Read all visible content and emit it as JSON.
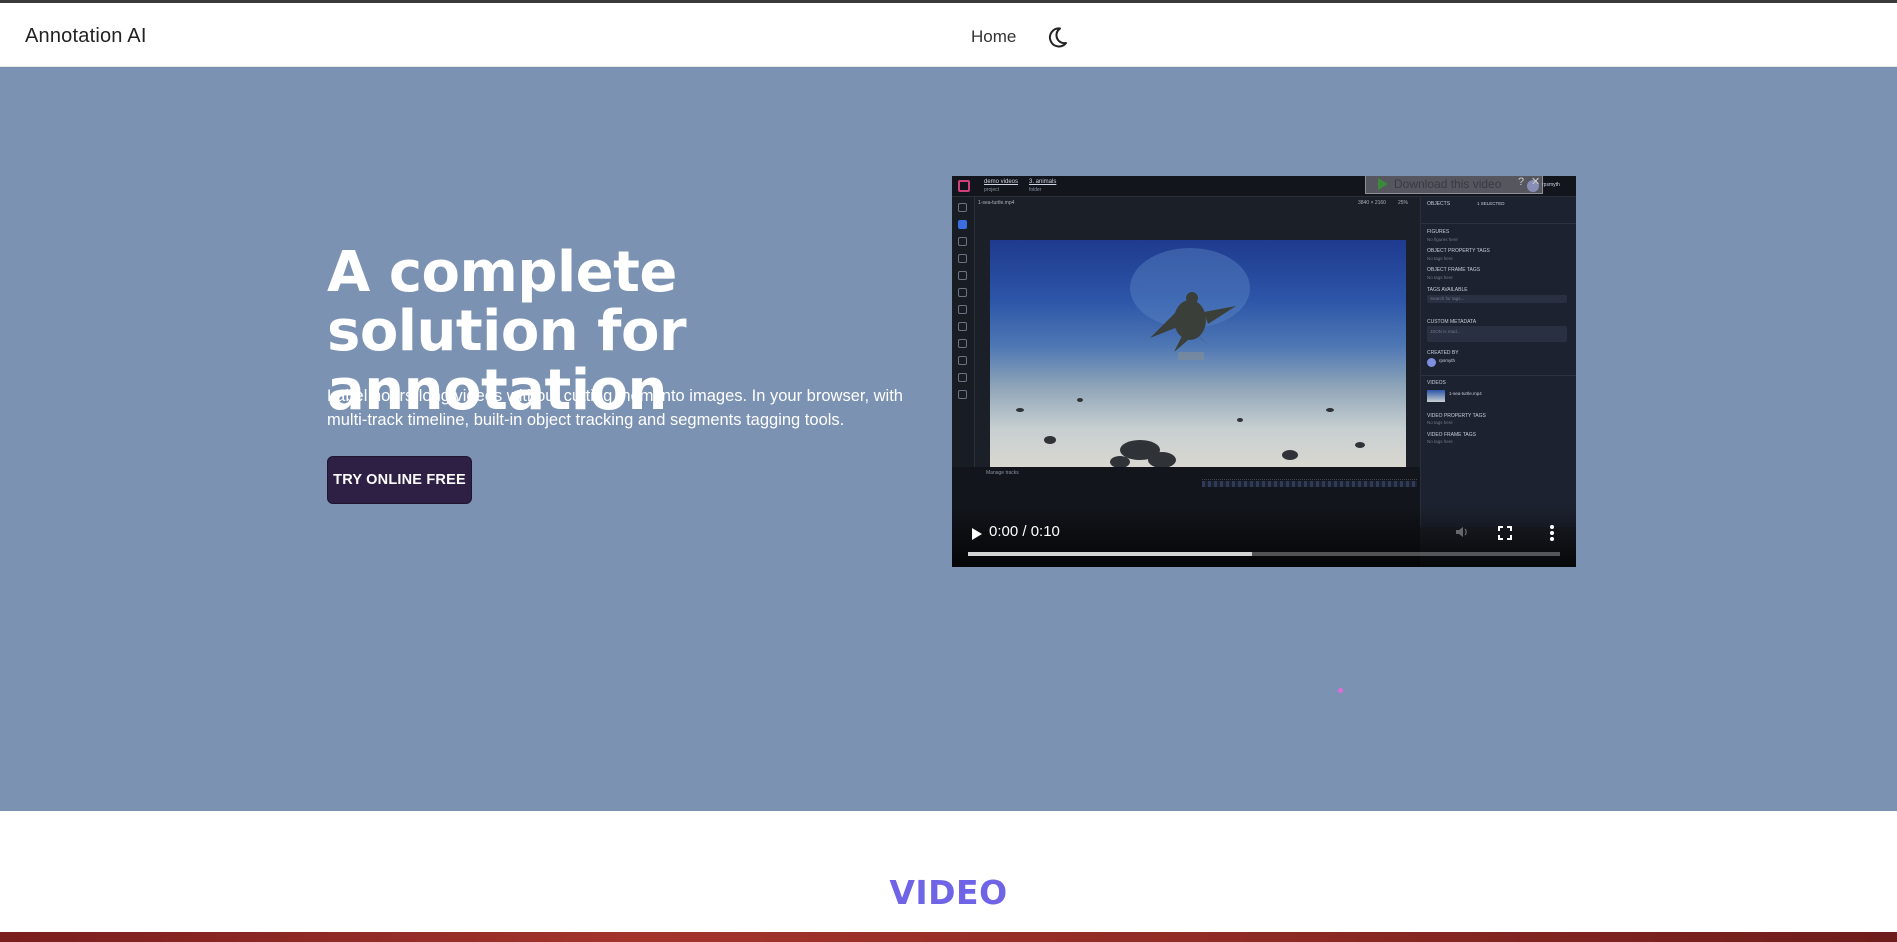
{
  "navbar": {
    "brand": "Annotation AI",
    "links": [
      {
        "label": "Home"
      }
    ],
    "theme_toggle_icon": "moon-icon"
  },
  "hero": {
    "title": "A complete solution for annotation",
    "subtitle": "Label hours-long videos without cutting them into images. In your browser, with multi-track timeline, built-in object tracking and segments tagging tools.",
    "cta_label": "TRY ONLINE FREE",
    "background_color": "#7b92b2",
    "cta_color": "#2e1f45"
  },
  "video_player": {
    "download_label": "Download this video",
    "time_display": "0:00 / 0:10",
    "progress_fraction": 0.48,
    "screen": {
      "breadcrumb_project": "demo videos",
      "breadcrumb_project_sub": "project",
      "breadcrumb_folder": "3. animals",
      "breadcrumb_folder_sub": "folder",
      "user": "rpsmyth",
      "file_name": "1-sea-turtle.mp4",
      "resolution": "3840 × 2160",
      "zoom": "25%",
      "panel_rows": [
        {
          "label": "OBJECTS",
          "sub": "1 SELECTED"
        },
        {
          "label": "FIGURES",
          "sub": "No figures here"
        },
        {
          "label": "OBJECT PROPERTY TAGS",
          "sub": "No tags here"
        },
        {
          "label": "OBJECT FRAME TAGS",
          "sub": "No tags here"
        },
        {
          "label": "TAGS AVAILABLE",
          "sub": "Search for tags..."
        },
        {
          "label": "CUSTOM METADATA",
          "sub": "JSON is read..."
        },
        {
          "label": "CREATED BY",
          "sub": "rpsmyth"
        },
        {
          "label": "VIDEOS",
          "sub": "1-sea-turtle.mp4"
        },
        {
          "label": "VIDEO PROPERTY TAGS",
          "sub": "No tags here"
        },
        {
          "label": "VIDEO FRAME TAGS",
          "sub": "No tags here"
        }
      ],
      "timeline_label": "Manage tracks"
    }
  },
  "section": {
    "title": "VIDEO",
    "title_color": "#6f63e6"
  }
}
